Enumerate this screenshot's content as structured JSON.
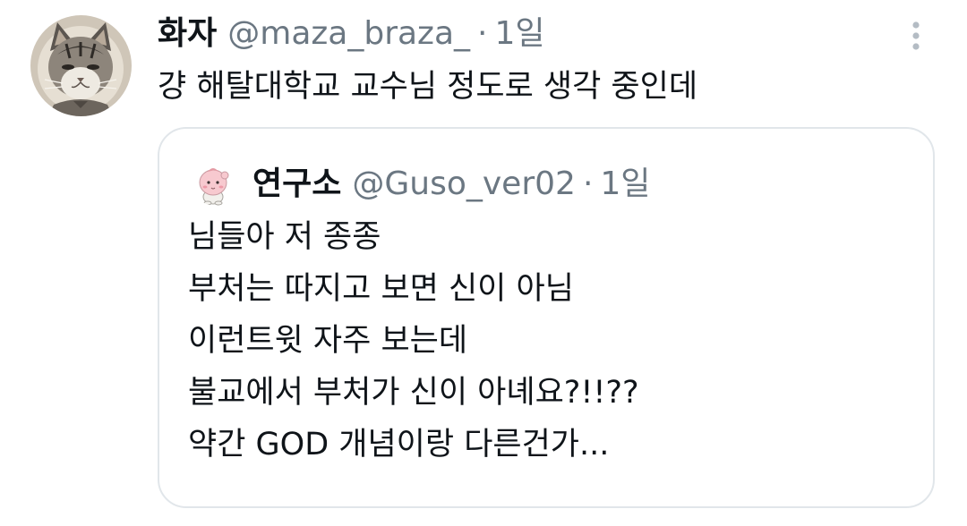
{
  "tweet": {
    "display_name": "화자",
    "handle": "@maza_braza_",
    "separator": "·",
    "time": "1일",
    "text": "걍 해탈대학교 교수님 정도로 생각 중인데",
    "avatar_icon": "cat-avatar-icon",
    "more_icon": "more-vertical-icon"
  },
  "quote": {
    "display_name": "연구소",
    "handle": "@Guso_ver02",
    "separator": "·",
    "time": "1일",
    "avatar_icon": "cartoon-character-avatar-icon",
    "lines": [
      "님들아 저 종종",
      "부처는 따지고 보면 신이 아님",
      "이런트윗 자주 보는데",
      "불교에서 부처가 신이 아녜요?!!??",
      "약간 GOD 개념이랑 다른건가..."
    ]
  },
  "colors": {
    "text_primary": "#0f1419",
    "text_secondary": "#6b7782",
    "border": "#e1e6ea",
    "background": "#ffffff"
  }
}
